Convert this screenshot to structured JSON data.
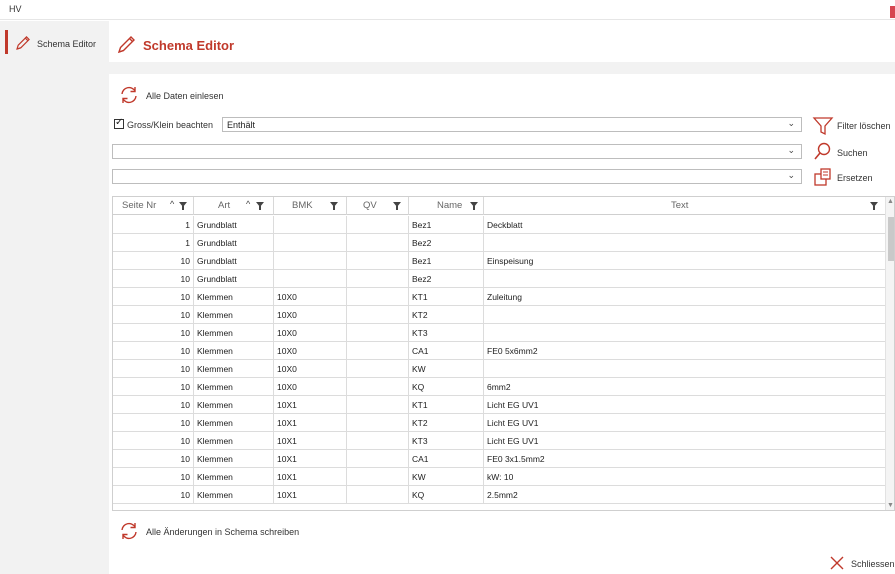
{
  "window": {
    "app_title": "HV"
  },
  "sidebar": {
    "items": [
      {
        "label": "Schema Editor",
        "icon": "pencil-icon"
      }
    ]
  },
  "header": {
    "title": "Schema Editor"
  },
  "actions": {
    "load_all": "Alle Daten einlesen",
    "write_changes": "Alle Änderungen in Schema schreiben",
    "close": "Schliessen"
  },
  "filter": {
    "case_sensitive_label": "Gross/Klein beachten",
    "case_sensitive_checked": true,
    "mode_value": "Enthält",
    "search_value": "",
    "replace_value": "",
    "clear_filter": "Filter löschen",
    "search": "Suchen",
    "replace": "Ersetzen"
  },
  "table": {
    "columns": [
      "Seite Nr",
      "Art",
      "BMK",
      "QV",
      "Name",
      "Text"
    ],
    "rows": [
      [
        "1",
        "Grundblatt",
        "",
        "",
        "Bez1",
        "Deckblatt"
      ],
      [
        "1",
        "Grundblatt",
        "",
        "",
        "Bez2",
        ""
      ],
      [
        "10",
        "Grundblatt",
        "",
        "",
        "Bez1",
        "Einspeisung"
      ],
      [
        "10",
        "Grundblatt",
        "",
        "",
        "Bez2",
        ""
      ],
      [
        "10",
        "Klemmen",
        "10X0",
        "",
        "KT1",
        "Zuleitung"
      ],
      [
        "10",
        "Klemmen",
        "10X0",
        "",
        "KT2",
        ""
      ],
      [
        "10",
        "Klemmen",
        "10X0",
        "",
        "KT3",
        ""
      ],
      [
        "10",
        "Klemmen",
        "10X0",
        "",
        "CA1",
        "FE0 5x6mm2"
      ],
      [
        "10",
        "Klemmen",
        "10X0",
        "",
        "KW",
        ""
      ],
      [
        "10",
        "Klemmen",
        "10X0",
        "",
        "KQ",
        "6mm2"
      ],
      [
        "10",
        "Klemmen",
        "10X1",
        "",
        "KT1",
        "Licht EG UV1"
      ],
      [
        "10",
        "Klemmen",
        "10X1",
        "",
        "KT2",
        "Licht EG UV1"
      ],
      [
        "10",
        "Klemmen",
        "10X1",
        "",
        "KT3",
        "Licht EG UV1"
      ],
      [
        "10",
        "Klemmen",
        "10X1",
        "",
        "CA1",
        "FE0 3x1.5mm2"
      ],
      [
        "10",
        "Klemmen",
        "10X1",
        "",
        "KW",
        "kW: 10"
      ],
      [
        "10",
        "Klemmen",
        "10X1",
        "",
        "KQ",
        "2.5mm2"
      ]
    ]
  },
  "colors": {
    "accent": "#c0392b",
    "sidebar_bg": "#f2f2f2",
    "grid_line": "#dcdcdc"
  }
}
